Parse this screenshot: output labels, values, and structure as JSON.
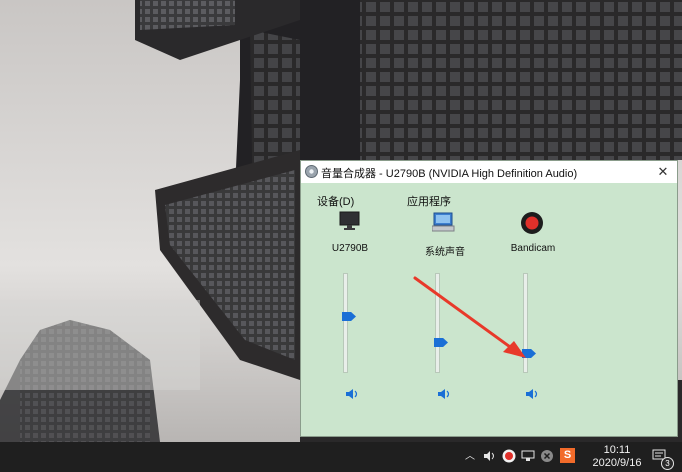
{
  "mixer": {
    "title": "音量合成器 - U2790B (NVIDIA High Definition Audio)",
    "close": "✕",
    "device_section_label": "设备(D)",
    "apps_section_label": "应用程序",
    "channels": [
      {
        "name": "U2790B",
        "icon": "monitor-icon",
        "level": 0.57
      },
      {
        "name": "系统声音",
        "icon": "system-sounds-icon",
        "level": 0.31
      },
      {
        "name": "Bandicam",
        "icon": "bandicam-record-icon",
        "level": 0.2
      }
    ]
  },
  "taskbar": {
    "clock_time": "10:11",
    "clock_date": "2020/9/16",
    "notification_count": "3",
    "sogou_label": "S"
  },
  "colors": {
    "mixer_bg": "#cbe5cd",
    "slider_thumb": "#1a6fd6",
    "annotation_arrow": "#e8392a",
    "bandicam_red": "#e0302a"
  }
}
